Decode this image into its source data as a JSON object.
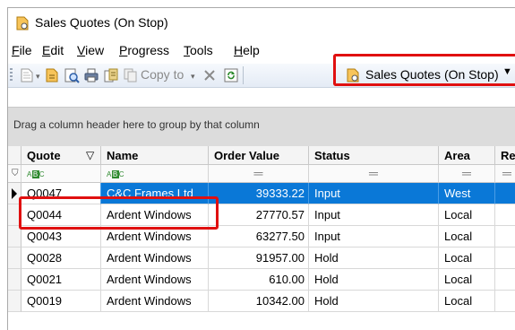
{
  "window": {
    "title": "Sales Quotes (On Stop)"
  },
  "menu": [
    {
      "first": "F",
      "rest": "ile"
    },
    {
      "first": "E",
      "rest": "dit"
    },
    {
      "first": "V",
      "rest": "iew"
    },
    {
      "first": "P",
      "rest": "rogress"
    },
    {
      "first": "T",
      "rest": "ools"
    },
    {
      "first": "H",
      "rest": "elp"
    }
  ],
  "toolbar": {
    "copy_to_label": "Copy to",
    "view_dropdown_label": "Sales Quotes (On Stop)",
    "icons": [
      "new-icon",
      "open-icon",
      "preview-icon",
      "print-icon",
      "export-icon",
      "copy-icon",
      "delete-icon",
      "refresh-icon"
    ]
  },
  "grid": {
    "group_hint": "Drag a column header here to group by that column",
    "columns": [
      "Quote",
      "Name",
      "Order Value",
      "Status",
      "Area",
      "Re"
    ],
    "rows": [
      {
        "quote": "Q0047",
        "name": "C&C Frames Ltd",
        "value": "39333.22",
        "status": "Input",
        "area": "West"
      },
      {
        "quote": "Q0044",
        "name": "Ardent Windows",
        "value": "27770.57",
        "status": "Input",
        "area": "Local"
      },
      {
        "quote": "Q0043",
        "name": "Ardent Windows",
        "value": "63277.50",
        "status": "Input",
        "area": "Local"
      },
      {
        "quote": "Q0028",
        "name": "Ardent Windows",
        "value": "91957.00",
        "status": "Hold",
        "area": "Local"
      },
      {
        "quote": "Q0021",
        "name": "Ardent Windows",
        "value": "610.00",
        "status": "Hold",
        "area": "Local"
      },
      {
        "quote": "Q0019",
        "name": "Ardent Windows",
        "value": "10342.00",
        "status": "Hold",
        "area": "Local"
      }
    ]
  },
  "colors": {
    "selection": "#0a78d7",
    "highlight_box": "#e01010",
    "icon_orange": "#f0a020"
  }
}
